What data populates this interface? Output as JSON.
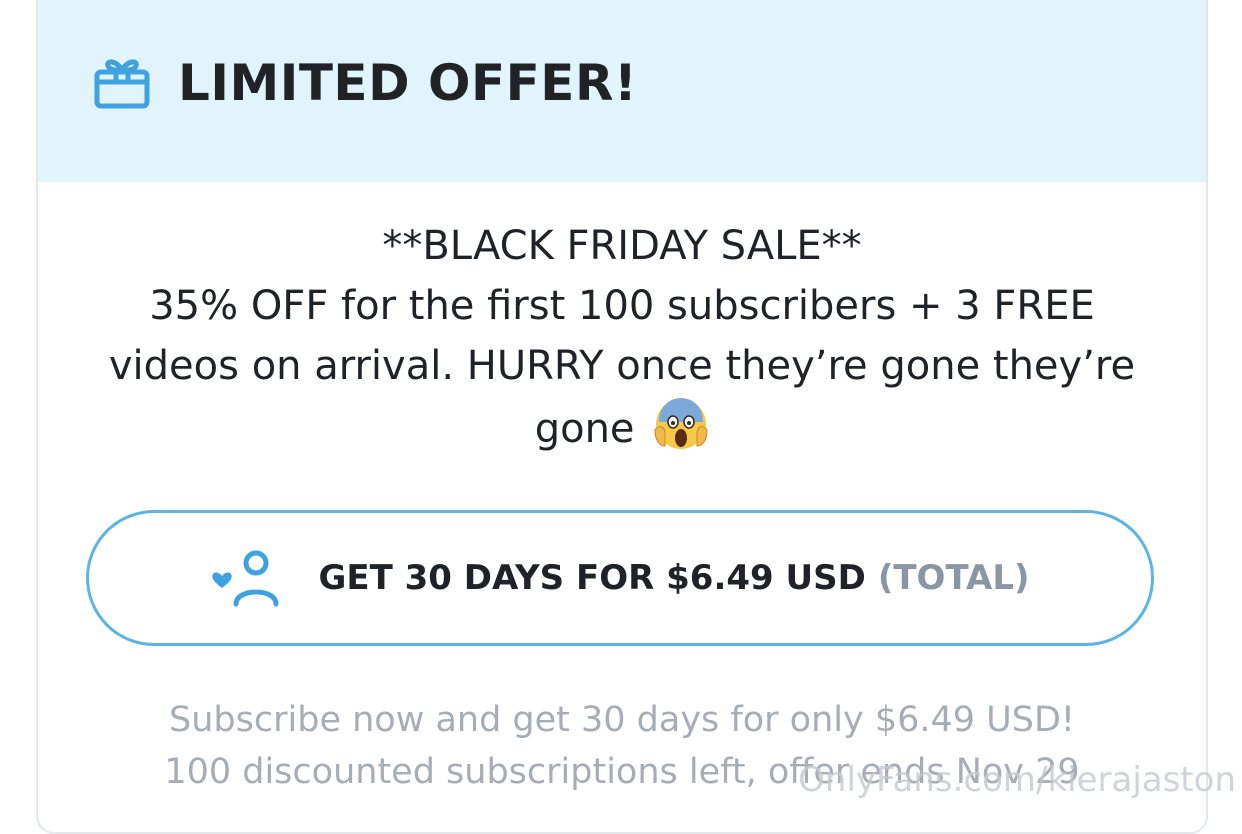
{
  "header": {
    "icon": "gift-icon",
    "title": "LIMITED OFFER!"
  },
  "description": {
    "line1": "**BLACK FRIDAY SALE**",
    "line2": "35% OFF for the first 100 subscribers + 3 FREE",
    "line3": "videos on arrival. HURRY once they’re gone they’re",
    "line4": "gone",
    "emoji": "face-screaming-in-fear-emoji"
  },
  "subscribe_button": {
    "icon": "subscribe-user-heart-icon",
    "label": "GET 30 DAYS FOR $6.49 USD",
    "suffix": "(TOTAL)"
  },
  "footnote": {
    "line1": "Subscribe now and get 30 days for only $6.49 USD!",
    "line2": "100 discounted subscriptions left, offer ends Nov 29"
  },
  "watermark": "OnlyFans.com/kierajaston",
  "colors": {
    "header_bg": "#e1f3fb",
    "accent": "#5cb3e6",
    "text": "#1f2328",
    "muted": "#a6adb5",
    "total": "#8a96a3"
  }
}
